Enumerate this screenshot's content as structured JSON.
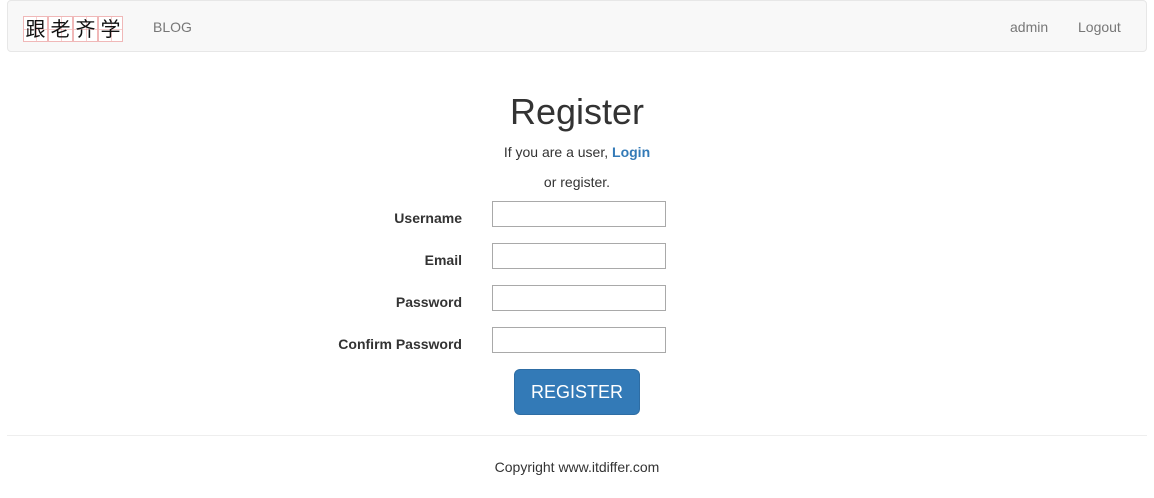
{
  "navbar": {
    "logo_chars": [
      "跟",
      "老",
      "齐",
      "学"
    ],
    "blog_label": "BLOG",
    "user_label": "admin",
    "logout_label": "Logout"
  },
  "main": {
    "title": "Register",
    "intro_prefix": "If you are a user,",
    "login_label": "Login",
    "intro_suffix": "or register.",
    "fields": [
      {
        "label": "Username",
        "value": "",
        "type": "text"
      },
      {
        "label": "Email",
        "value": "",
        "type": "email"
      },
      {
        "label": "Password",
        "value": "",
        "type": "password"
      },
      {
        "label": "Confirm Password",
        "value": "",
        "type": "password"
      }
    ],
    "submit_label": "REGISTER"
  },
  "footer": {
    "copyright": "Copyright www.itdiffer.com"
  },
  "colors": {
    "accent": "#337ab7",
    "navbar_bg": "#f8f8f8",
    "nav_text": "#777777"
  }
}
